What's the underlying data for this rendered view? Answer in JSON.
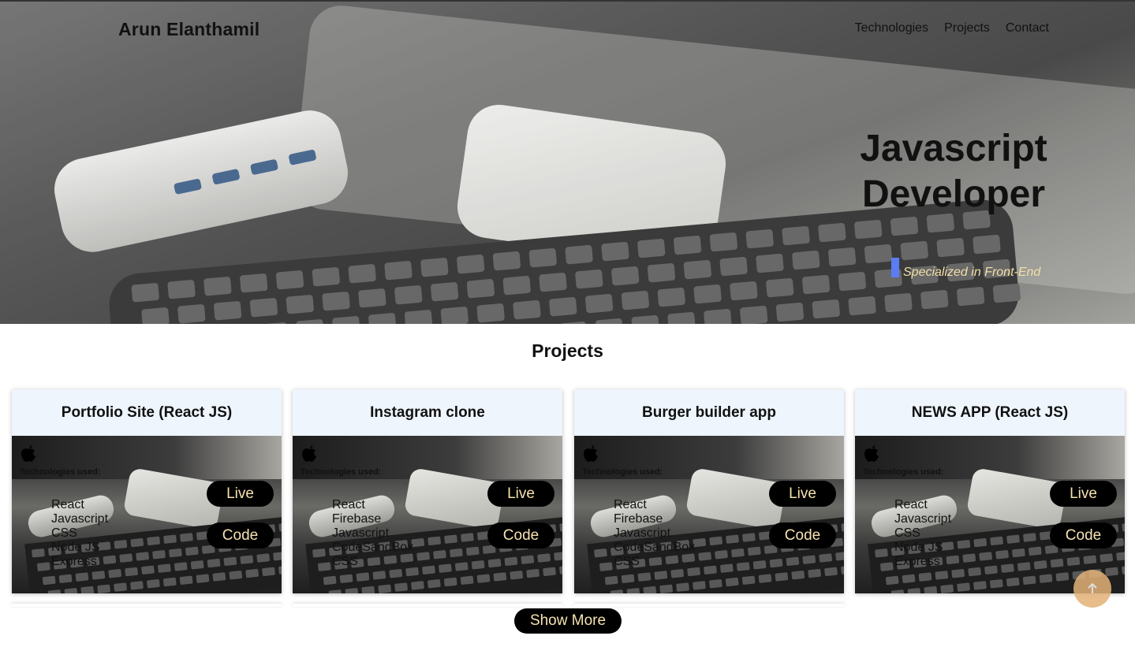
{
  "nav": {
    "brand": "Arun Elanthamil",
    "links": [
      "Technologies",
      "Projects",
      "Contact"
    ]
  },
  "hero": {
    "headline_line1": "Javascript",
    "headline_line2": "Developer",
    "tagline": "Specialized in Front-End",
    "tagline_color": "#f2dfa6",
    "accent_color": "#5b7cf2"
  },
  "projects": {
    "title": "Projects",
    "tech_label": "Technologies used:",
    "live_label": "Live",
    "code_label": "Code",
    "show_more_label": "Show More",
    "cards": [
      {
        "title": "Portfolio Site (React JS)",
        "tech": [
          "React",
          "Javascript",
          "CSS",
          "Node JS",
          "Express"
        ]
      },
      {
        "title": "Instagram clone",
        "tech": [
          "React",
          "Firebase",
          "Javascript",
          "CodeSandBox",
          "CSS"
        ]
      },
      {
        "title": "Burger builder app",
        "tech": [
          "React",
          "Firebase",
          "Javascript",
          "CodeSandBox",
          "CSS"
        ]
      },
      {
        "title": "NEWS APP (React JS)",
        "tech": [
          "React",
          "Javascript",
          "CSS",
          "Node JS",
          "Express"
        ]
      }
    ]
  },
  "colors": {
    "card_header_bg": "#eef5fc",
    "pill_bg": "#000000",
    "pill_text": "#f6e2b0",
    "scroll_top_button": "#e3b277"
  },
  "icons": {
    "card_logo": "apple-icon",
    "scroll_top": "arrow-up-icon"
  }
}
